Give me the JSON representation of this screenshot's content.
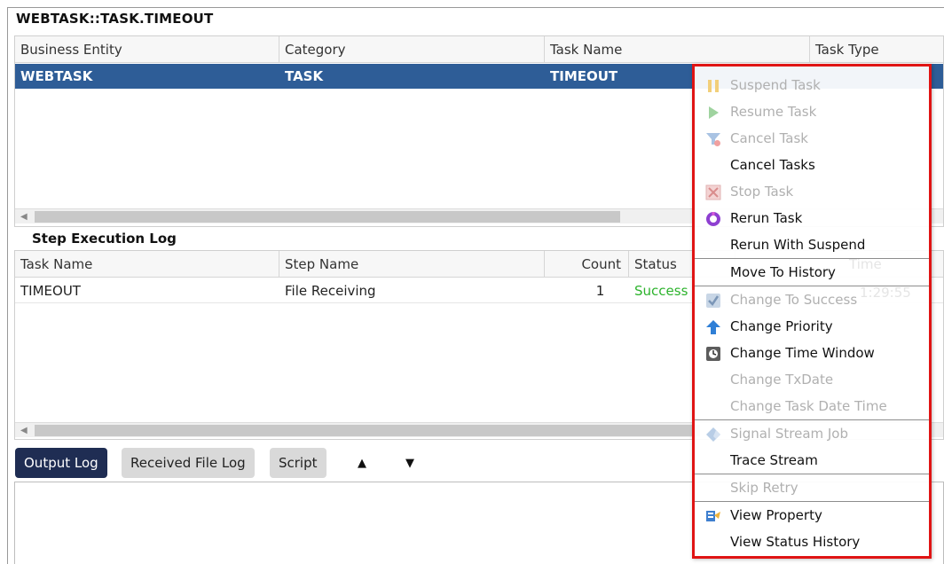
{
  "window": {
    "title": "WEBTASK::TASK.TIMEOUT"
  },
  "task_grid": {
    "columns": [
      "Business Entity",
      "Category",
      "Task Name",
      "Task Type"
    ],
    "selected_row": [
      "WEBTASK",
      "TASK",
      "TIMEOUT"
    ]
  },
  "step_log": {
    "title": "Step Execution Log",
    "columns": [
      "Task Name",
      "Step Name",
      "Count",
      "Status"
    ],
    "rows": [
      [
        "TIMEOUT",
        "File Receiving",
        "1",
        "Success"
      ]
    ],
    "ghost_time_header": "Time",
    "ghost_time_value": "1:29:55"
  },
  "tabs": [
    {
      "label": "Output Log",
      "active": true
    },
    {
      "label": "Received File Log",
      "active": false
    },
    {
      "label": "Script",
      "active": false
    }
  ],
  "tab_arrows": {
    "up": "▲",
    "down": "▼"
  },
  "context_menu": {
    "items": [
      {
        "label": "Suspend Task",
        "enabled": false,
        "icon": "pause-icon"
      },
      {
        "label": "Resume Task",
        "enabled": false,
        "icon": "play-icon"
      },
      {
        "label": "Cancel Task",
        "enabled": false,
        "icon": "cancel-filter-icon"
      },
      {
        "label": "Cancel Tasks",
        "enabled": true,
        "icon": ""
      },
      {
        "label": "Stop Task",
        "enabled": false,
        "icon": "stop-x-icon"
      },
      {
        "label": "Rerun Task",
        "enabled": true,
        "icon": "rerun-circle-icon"
      },
      {
        "label": "Rerun With Suspend",
        "enabled": true,
        "icon": ""
      },
      {
        "label": "Move To History",
        "enabled": true,
        "icon": ""
      },
      {
        "label": "Change To Success",
        "enabled": false,
        "icon": "checkmark-icon"
      },
      {
        "label": "Change Priority",
        "enabled": true,
        "icon": "arrow-up-icon"
      },
      {
        "label": "Change Time Window",
        "enabled": true,
        "icon": "clock-icon"
      },
      {
        "label": "Change TxDate",
        "enabled": false,
        "icon": ""
      },
      {
        "label": "Change Task Date Time",
        "enabled": false,
        "icon": ""
      },
      {
        "label": "Signal Stream Job",
        "enabled": false,
        "icon": "signal-diamond-icon"
      },
      {
        "label": "Trace Stream",
        "enabled": true,
        "icon": ""
      },
      {
        "label": "Skip Retry",
        "enabled": false,
        "icon": ""
      },
      {
        "label": "View Property",
        "enabled": true,
        "icon": "property-icon"
      },
      {
        "label": "View Status History",
        "enabled": true,
        "icon": ""
      }
    ]
  },
  "colors": {
    "selection": "#2e5d97",
    "active_tab": "#1f2d53",
    "success": "#2db32d",
    "highlight_border": "#e01414"
  }
}
